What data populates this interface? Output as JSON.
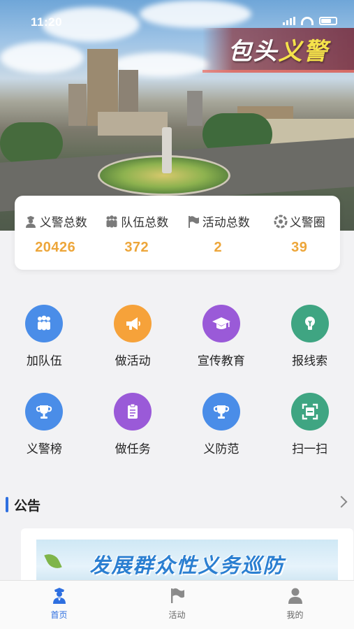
{
  "status_bar": {
    "time": "11:20"
  },
  "hero": {
    "title_white": "包头",
    "title_yellow": "义警"
  },
  "stats": [
    {
      "icon": "police-officer-icon",
      "label": "义警总数",
      "value": "20426"
    },
    {
      "icon": "team-icon",
      "label": "队伍总数",
      "value": "372"
    },
    {
      "icon": "flag-icon",
      "label": "活动总数",
      "value": "2"
    },
    {
      "icon": "circle-icon",
      "label": "义警圈",
      "value": "39"
    }
  ],
  "features": [
    {
      "label": "加队伍",
      "icon": "team-icon",
      "color": "#4a8de8"
    },
    {
      "label": "做活动",
      "icon": "megaphone-icon",
      "color": "#f6a23a"
    },
    {
      "label": "宣传教育",
      "icon": "graduation-cap-icon",
      "color": "#9a5ad8"
    },
    {
      "label": "报线索",
      "icon": "lightbulb-icon",
      "color": "#3fa582"
    },
    {
      "label": "义警榜",
      "icon": "trophy-icon",
      "color": "#4a8de8"
    },
    {
      "label": "做任务",
      "icon": "clipboard-icon",
      "color": "#9a5ad8"
    },
    {
      "label": "义防范",
      "icon": "trophy-icon",
      "color": "#4a8de8"
    },
    {
      "label": "扫一扫",
      "icon": "scan-icon",
      "color": "#3fa582"
    }
  ],
  "notice": {
    "title": "公告",
    "banner_text": "发展群众性义务巡防"
  },
  "tabbar": [
    {
      "label": "首页",
      "icon": "police-officer-icon",
      "active": true
    },
    {
      "label": "活动",
      "icon": "flag-icon",
      "active": false
    },
    {
      "label": "我的",
      "icon": "user-icon",
      "active": false
    }
  ],
  "colors": {
    "accent": "#2e6fe0",
    "stat_value": "#eda63a"
  }
}
